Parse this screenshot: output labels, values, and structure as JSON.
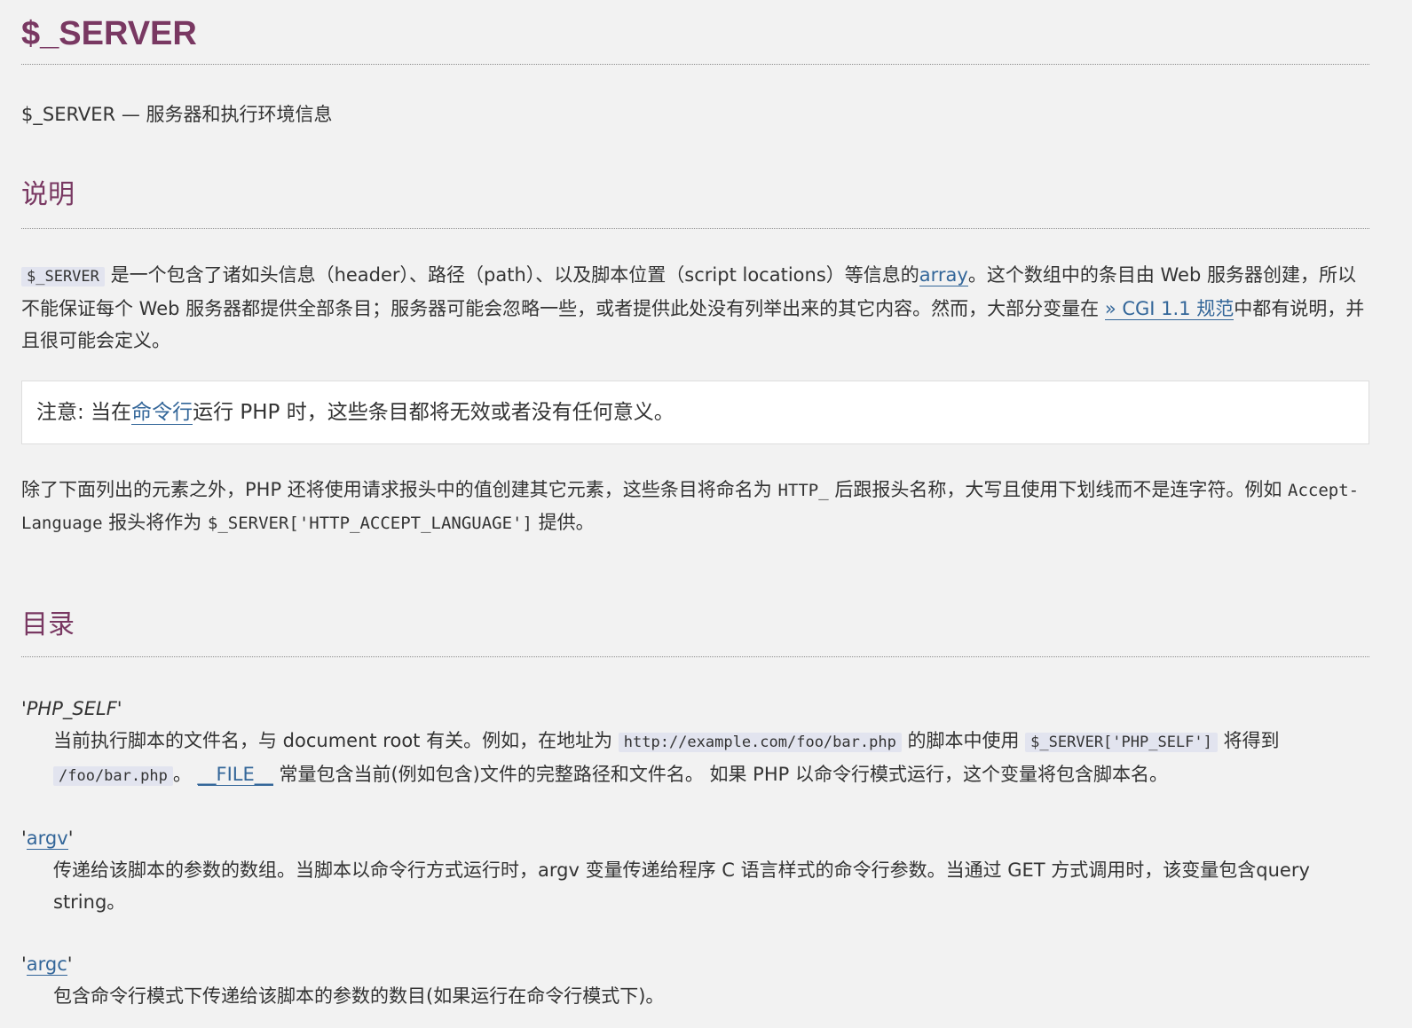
{
  "title": "$_SERVER",
  "refpurpose": {
    "name": "$_SERVER",
    "dash": "—",
    "desc": "服务器和执行环境信息"
  },
  "desc_heading": "说明",
  "para1": {
    "code": "$_SERVER",
    "text1": "是一个包含了诸如头信息（header）、路径（path）、以及脚本位置（script locations）等信息的",
    "link_array": "array",
    "text2": "。这个数组中的条目由 Web 服务器创建，所以不能保证每个 Web 服务器都提供全部条目；服务器可能会忽略一些，或者提供此处没有列举出来的其它内容。然而，大部分变量在",
    "link_cgi": "» CGI 1.1 规范",
    "text3": "中都有说明，并且很可能会定义。"
  },
  "note": {
    "label": "注意:",
    "text1": " 当在",
    "link": "命令行",
    "text2": "运行 PHP 时，这些条目都将无效或者没有任何意义。"
  },
  "para2": {
    "text1": "除了下面列出的元素之外，PHP 还将使用请求报头中的值创建其它元素，这些条目将命名为 ",
    "code1": "HTTP_",
    "text2": " 后跟报头名称，大写且使用下划线而不是连字符。例如 ",
    "code2": "Accept-Language",
    "text3": " 报头将作为 ",
    "code3": "$_SERVER['HTTP_ACCEPT_LANGUAGE']",
    "text4": " 提供。"
  },
  "toc_heading": "目录",
  "entries": {
    "php_self": {
      "term": "'PHP_SELF'",
      "text1": "当前执行脚本的文件名，与 document root 有关。例如，在地址为 ",
      "code1": "http://example.com/foo/bar.php",
      "text2": " 的脚本中使用 ",
      "code2": "$_SERVER['PHP_SELF']",
      "text3": " 将得到 ",
      "code3": "/foo/bar.php",
      "text4": "。",
      "link": "__FILE__",
      "text5": " 常量包含当前(例如包含)文件的完整路径和文件名。 如果 PHP 以命令行模式运行，这个变量将包含脚本名。"
    },
    "argv": {
      "q1": "'",
      "term": "argv",
      "q2": "'",
      "text": "传递给该脚本的参数的数组。当脚本以命令行方式运行时，argv 变量传递给程序 C 语言样式的命令行参数。当通过 GET 方式调用时，该变量包含query string。"
    },
    "argc": {
      "q1": "'",
      "term": "argc",
      "q2": "'",
      "text": "包含命令行模式下传递给该脚本的参数的数目(如果运行在命令行模式下)。"
    }
  }
}
